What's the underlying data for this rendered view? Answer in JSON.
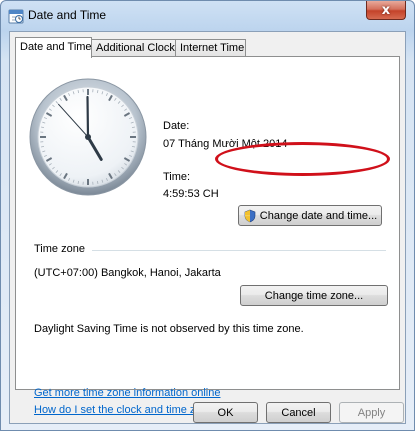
{
  "window": {
    "title": "Date and Time",
    "close_glyph": "x",
    "icon": "date-time-icon"
  },
  "tabs": [
    {
      "label": "Date and Time",
      "active": true
    },
    {
      "label": "Additional Clocks",
      "active": false
    },
    {
      "label": "Internet Time",
      "active": false
    }
  ],
  "datetime": {
    "date_label": "Date:",
    "date_value": "07 Tháng Mười Một 2014",
    "time_label": "Time:",
    "time_value": "4:59:53 CH",
    "change_button_label": "Change date and time...",
    "change_button_icon": "uac-shield-icon"
  },
  "timezone": {
    "section_label": "Time zone",
    "value": "(UTC+07:00) Bangkok, Hanoi, Jakarta",
    "change_button_label": "Change time zone...",
    "dst_note": "Daylight Saving Time is not observed by this time zone."
  },
  "links": {
    "more_info": "Get more time zone information online",
    "how_to": "How do I set the clock and time zone?"
  },
  "footer": {
    "ok_label": "OK",
    "cancel_label": "Cancel",
    "apply_label": "Apply"
  },
  "clock": {
    "hours": 4,
    "minutes": 59,
    "seconds": 53
  },
  "colors": {
    "highlight": "#d0101a",
    "link": "#0066cc"
  }
}
